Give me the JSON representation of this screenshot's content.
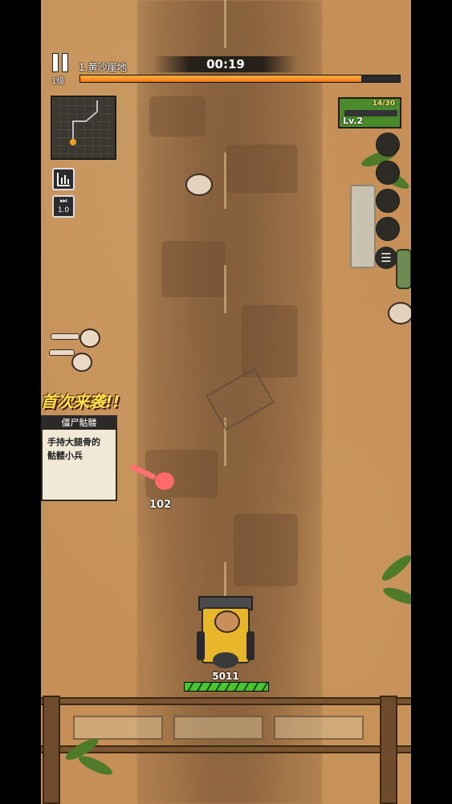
{
  "hud": {
    "player_level": "1级",
    "stage_name": "1.黄沙崖地",
    "timer": "00:19",
    "progress_fraction": 0.88,
    "speed_label": "1.0"
  },
  "weapon": {
    "ammo": "14/30",
    "level": "Lv.2"
  },
  "combat": {
    "damage_popup": "102",
    "truck_hp": "5011"
  },
  "first_wave": {
    "banner": "首次来袭!!",
    "enemy_name": "僵尸骷髅",
    "enemy_desc_line1": "手持大腿骨的",
    "enemy_desc_line2": "骷髅小兵"
  },
  "colors": {
    "sand": "#c58f57",
    "progress": "#f07818",
    "hp": "#49c531",
    "banner_text": "#ffe24a"
  },
  "icons": [
    "pause-icon",
    "stats-icon",
    "fast-forward-icon",
    "list-icon",
    "shotgun-icon"
  ]
}
